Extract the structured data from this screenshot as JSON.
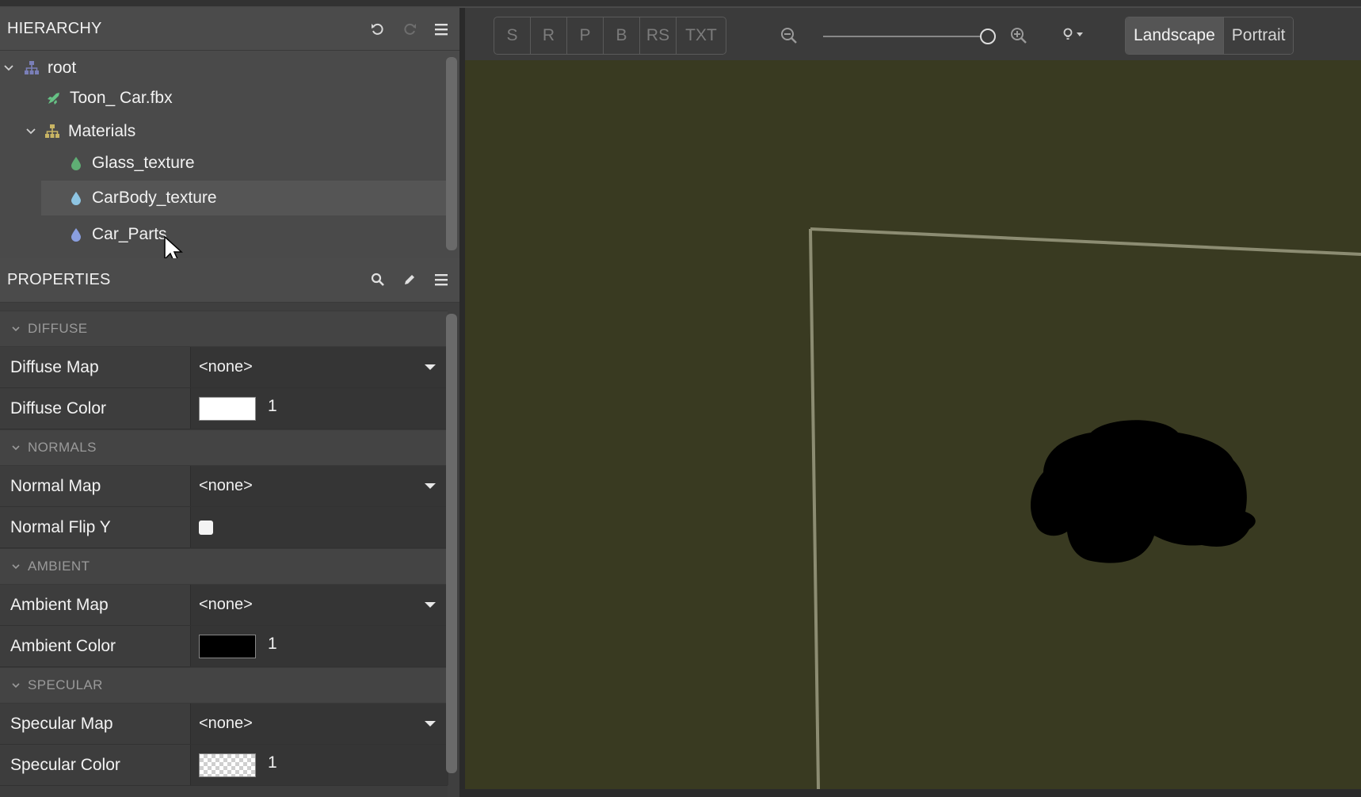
{
  "hierarchy": {
    "title": "HIERARCHY",
    "items": [
      {
        "label": "root",
        "icon": "hierarchy-icon"
      },
      {
        "label": "Toon_ Car.fbx",
        "icon": "model-icon"
      },
      {
        "label": "Materials",
        "icon": "hierarchy-icon"
      },
      {
        "label": "Glass_texture",
        "icon": "material-drop-icon"
      },
      {
        "label": "CarBody_texture",
        "icon": "material-drop-icon"
      },
      {
        "label": "Car_Parts",
        "icon": "material-drop-icon"
      }
    ]
  },
  "properties": {
    "title": "PROPERTIES",
    "sections": [
      {
        "title": "DIFFUSE"
      },
      {
        "title": "NORMALS"
      },
      {
        "title": "AMBIENT"
      },
      {
        "title": "SPECULAR"
      }
    ],
    "rows": {
      "diffuse_map": {
        "label": "Diffuse Map",
        "value": "<none>"
      },
      "diffuse_color": {
        "label": "Diffuse Color",
        "color": "#ffffff",
        "value": "1"
      },
      "normal_map": {
        "label": "Normal Map",
        "value": "<none>"
      },
      "normal_flip": {
        "label": "Normal Flip Y",
        "checked": false
      },
      "ambient_map": {
        "label": "Ambient Map",
        "value": "<none>"
      },
      "ambient_color": {
        "label": "Ambient Color",
        "color": "#000000",
        "value": "1"
      },
      "specular_map": {
        "label": "Specular Map",
        "value": "<none>"
      },
      "specular_color": {
        "label": "Specular Color",
        "color": "transparent",
        "value": "1"
      }
    }
  },
  "viewport": {
    "modes": [
      "S",
      "R",
      "P",
      "B",
      "RS",
      "TXT"
    ],
    "orientation": {
      "landscape": "Landscape",
      "portrait": "Portrait",
      "selected": "Landscape"
    },
    "background_color": "#393a21"
  }
}
